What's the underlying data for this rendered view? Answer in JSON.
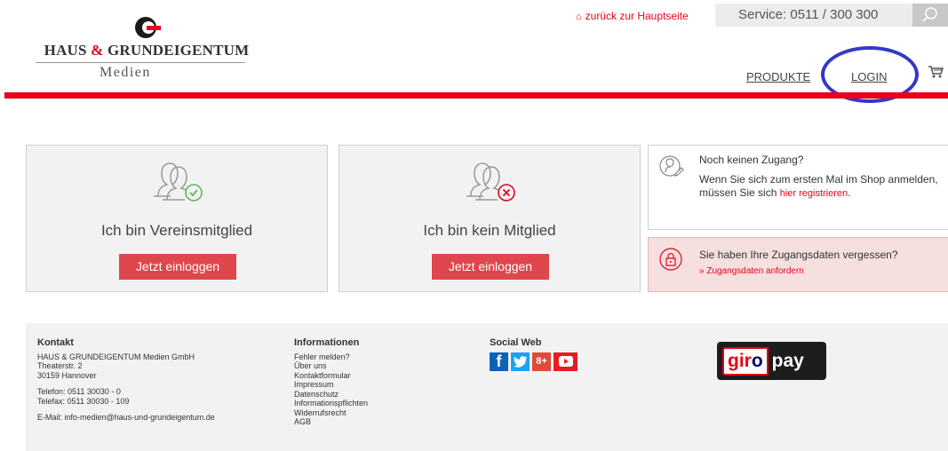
{
  "header": {
    "logo": {
      "line1_a": "HAUS ",
      "line1_amp": "&",
      "line1_b": " GRUNDEIGENTUM",
      "line2": "Medien"
    },
    "back_link": "zurück zur Hauptseite",
    "service": "Service: 0511 / 300 300",
    "nav": {
      "produkte": "PRODUKTE",
      "login": "LOGIN"
    },
    "accent_color": "#e3051b",
    "annotation_color": "#3338c6"
  },
  "cards": {
    "member": {
      "title": "Ich bin Vereinsmitglied",
      "button": "Jetzt einloggen"
    },
    "nonmember": {
      "title": "Ich bin kein Mitglied",
      "button": "Jetzt einloggen"
    }
  },
  "register": {
    "heading": "Noch keinen Zugang?",
    "text_1": "Wenn Sie sich zum ersten Mal im Shop anmelden,",
    "text_2": "müssen Sie sich ",
    "link": "hier registrieren",
    "text_3": "."
  },
  "forgot": {
    "heading": "Sie haben Ihre Zugangsdaten vergessen?",
    "link": "» Zugangsdaten anfordern"
  },
  "footer": {
    "kontakt": {
      "heading": "Kontakt",
      "lines": [
        "HAUS & GRUNDEIGENTUM Medien GmbH",
        "Theaterstr. 2",
        "30159 Hannover"
      ],
      "phone": "Telefon: 0511 30030 - 0",
      "fax": "Telefax: 0511 30030 - 109",
      "email": "E-Mail: info-medien@haus-und-grundeigentum.de"
    },
    "informationen": {
      "heading": "Informationen",
      "links": [
        "Fehler melden?",
        "Über uns",
        "Kontaktformular",
        "Impressum",
        "Datenschutz",
        "Informationspflichten",
        "Widerrufsrecht",
        "AGB"
      ]
    },
    "social": {
      "heading": "Social Web",
      "icons": [
        "facebook-icon",
        "twitter-icon",
        "google-plus-icon",
        "youtube-icon"
      ],
      "gplus_text": "8+"
    },
    "giropay": {
      "part1_a": "gir",
      "part1_b": "o",
      "part2": "pay"
    }
  }
}
